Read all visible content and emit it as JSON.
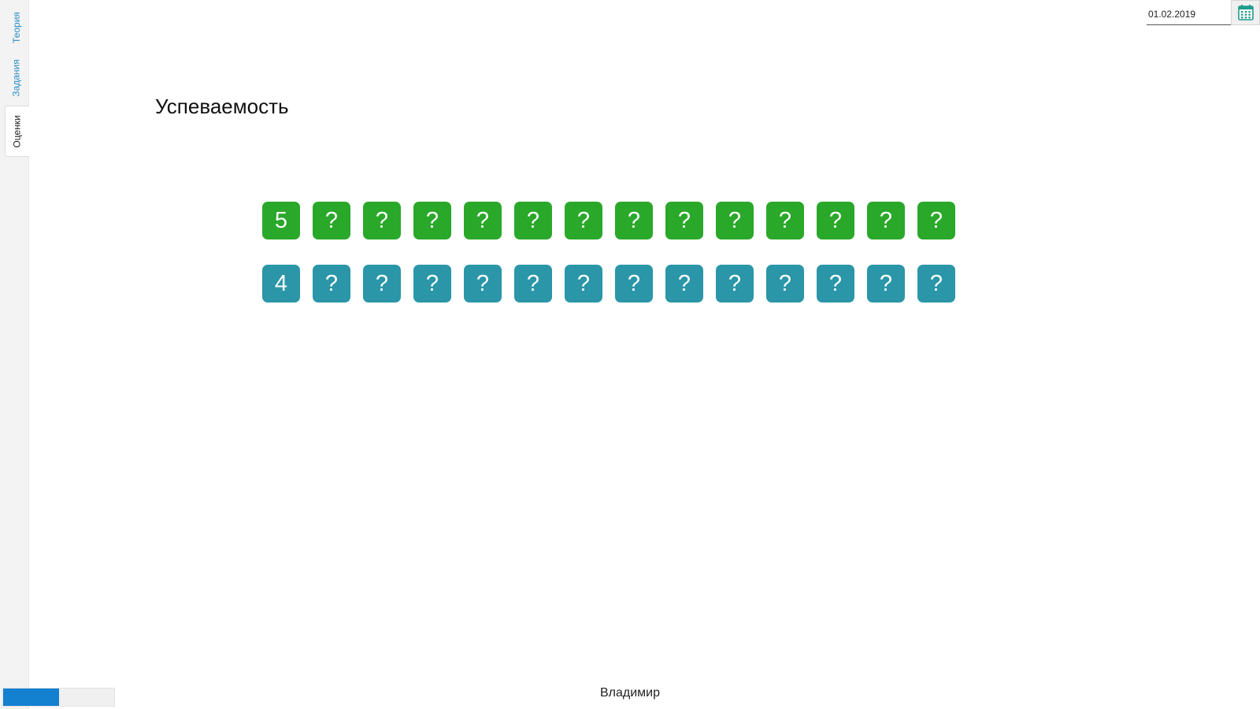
{
  "sidebar": {
    "tabs": [
      {
        "label": "Теория",
        "active": false
      },
      {
        "label": "Задания",
        "active": false
      },
      {
        "label": "Оценки",
        "active": true
      }
    ]
  },
  "header": {
    "title": "Успеваемость"
  },
  "date_picker": {
    "value": "01.02.2019",
    "icon": "calendar-icon"
  },
  "grades": {
    "rows": [
      {
        "color": "#2aa82a",
        "tiles": [
          "5",
          "?",
          "?",
          "?",
          "?",
          "?",
          "?",
          "?",
          "?",
          "?",
          "?",
          "?",
          "?",
          "?"
        ]
      },
      {
        "color": "#2a96a8",
        "tiles": [
          "4",
          "?",
          "?",
          "?",
          "?",
          "?",
          "?",
          "?",
          "?",
          "?",
          "?",
          "?",
          "?",
          "?"
        ]
      }
    ]
  },
  "footer": {
    "user_name": "Владимир",
    "progress_fraction": 0.5,
    "progress_color": "#1380d0"
  }
}
